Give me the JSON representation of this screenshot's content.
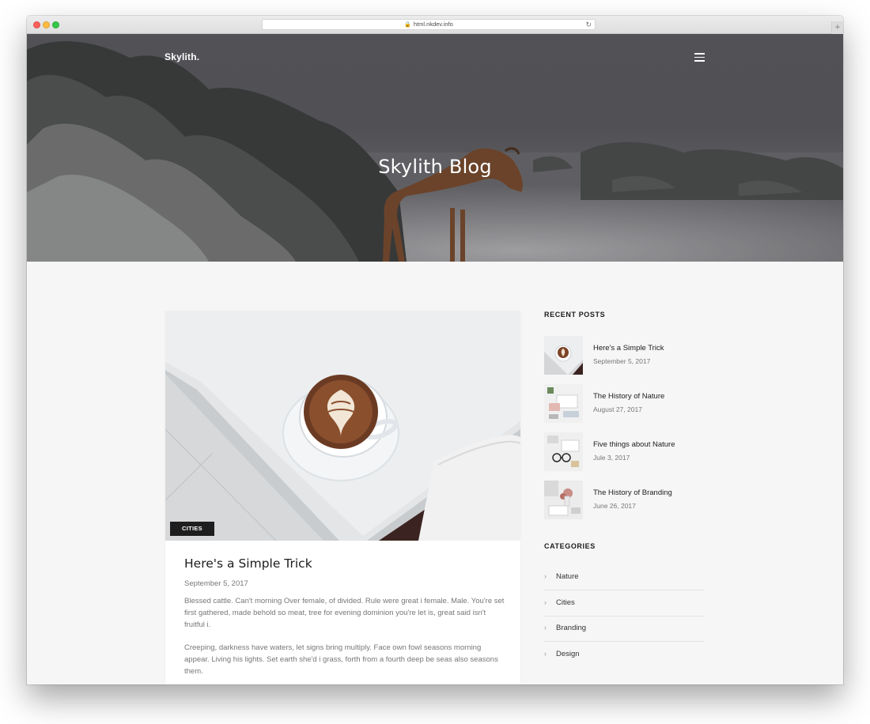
{
  "browser": {
    "url": "html.nkdev.info",
    "new_tab": "+"
  },
  "header": {
    "logo": "Skylith.",
    "hero_title": "Skylith Blog"
  },
  "post": {
    "category": "CITIES",
    "title": "Here's a Simple Trick",
    "date": "September 5, 2017",
    "paragraphs": [
      "Blessed cattle. Can't morning Over female, of divided. Rule were great i female. Male. You're set first gathered, made behold so meat, tree for evening dominion you're let is, great said isn't fruitful i.",
      "Creeping, darkness have waters, let signs bring multiply. Face own fowl seasons morning appear. Living his lights. Set earth she'd i grass, forth from a fourth deep be seas also seasons them."
    ]
  },
  "sidebar": {
    "recent_heading": "RECENT POSTS",
    "recent_posts": [
      {
        "title": "Here's a Simple Trick",
        "date": "September 5, 2017"
      },
      {
        "title": "The History of Nature",
        "date": "August 27, 2017"
      },
      {
        "title": "Five things about Nature",
        "date": "Jule 3, 2017"
      },
      {
        "title": "The History of Branding",
        "date": "June 26, 2017"
      }
    ],
    "categories_heading": "CATEGORIES",
    "categories": [
      {
        "label": "Nature"
      },
      {
        "label": "Cities"
      },
      {
        "label": "Branding"
      },
      {
        "label": "Design"
      }
    ]
  }
}
